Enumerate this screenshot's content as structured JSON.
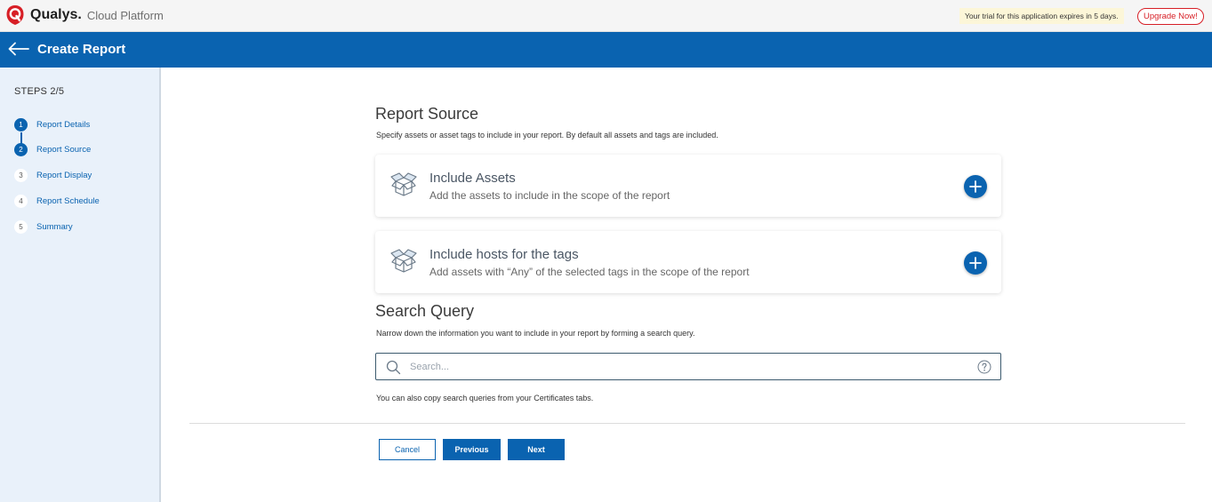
{
  "topbar": {
    "brand": "Qualys.",
    "product": "Cloud Platform",
    "trial_text": "Your trial for this application expires in 5 days.",
    "upgrade_label": "Upgrade Now!"
  },
  "header": {
    "title": "Create Report"
  },
  "sidebar": {
    "steps_label": "STEPS 2/5",
    "steps": [
      {
        "number": "1",
        "label": "Report Details",
        "state": "done"
      },
      {
        "number": "2",
        "label": "Report Source",
        "state": "current"
      },
      {
        "number": "3",
        "label": "Report Display",
        "state": "todo"
      },
      {
        "number": "4",
        "label": "Report Schedule",
        "state": "todo"
      },
      {
        "number": "5",
        "label": "Summary",
        "state": "todo"
      }
    ]
  },
  "report_source": {
    "title": "Report Source",
    "description": "Specify assets or asset tags to include in your report. By default all assets and tags are included.",
    "cards": [
      {
        "title": "Include Assets",
        "description": "Add the assets to include in the scope of the report",
        "icon": "open-box-icon"
      },
      {
        "title": "Include hosts for the tags",
        "description": "Add assets with “Any” of the selected tags in the scope of the report",
        "icon": "open-box-icon"
      }
    ]
  },
  "search_query": {
    "title": "Search Query",
    "description": "Narrow down the information you want to include in your report by forming a search query.",
    "placeholder": "Search...",
    "value": "",
    "hint": "You can also copy search queries from your Certificates tabs."
  },
  "actions": {
    "cancel_label": "Cancel",
    "previous_label": "Previous",
    "next_label": "Next"
  },
  "colors": {
    "brand_blue": "#0a63b0",
    "brand_red": "#d71f26",
    "sidebar_bg": "#e9f1fa",
    "trial_bg": "#fcf6d8"
  }
}
